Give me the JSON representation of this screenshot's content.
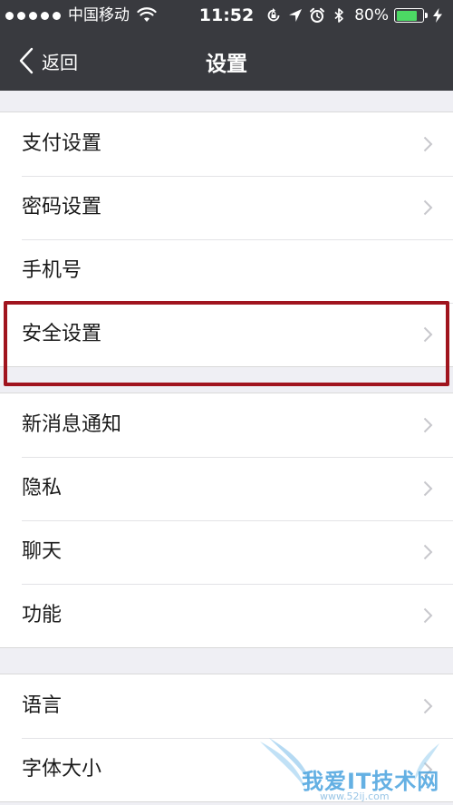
{
  "status_bar": {
    "carrier": "中国移动",
    "time": "11:52",
    "battery_percent": "80%",
    "battery_level": 0.8,
    "icons": [
      "signal-dots",
      "wifi-icon",
      "orientation-lock-icon",
      "location-arrow-icon",
      "alarm-icon",
      "bluetooth-icon",
      "battery-icon",
      "charging-icon"
    ]
  },
  "nav": {
    "back_label": "返回",
    "title": "设置"
  },
  "groups": [
    {
      "items": [
        {
          "label": "支付设置",
          "chevron": true
        },
        {
          "label": "密码设置",
          "chevron": true
        },
        {
          "label": "手机号",
          "chevron": false
        },
        {
          "label": "安全设置",
          "chevron": true
        }
      ]
    },
    {
      "items": [
        {
          "label": "新消息通知",
          "chevron": true
        },
        {
          "label": "隐私",
          "chevron": true
        },
        {
          "label": "聊天",
          "chevron": true
        },
        {
          "label": "功能",
          "chevron": true
        }
      ]
    },
    {
      "items": [
        {
          "label": "语言",
          "chevron": true
        },
        {
          "label": "字体大小",
          "chevron": true
        }
      ]
    }
  ],
  "watermark": {
    "text": "我爱IT技术网",
    "url": "www.52ij.com"
  },
  "colors": {
    "nav_background": "#393a3f",
    "page_background": "#efeff4",
    "highlight_border": "#a0141e",
    "battery_green": "#4cd964"
  }
}
